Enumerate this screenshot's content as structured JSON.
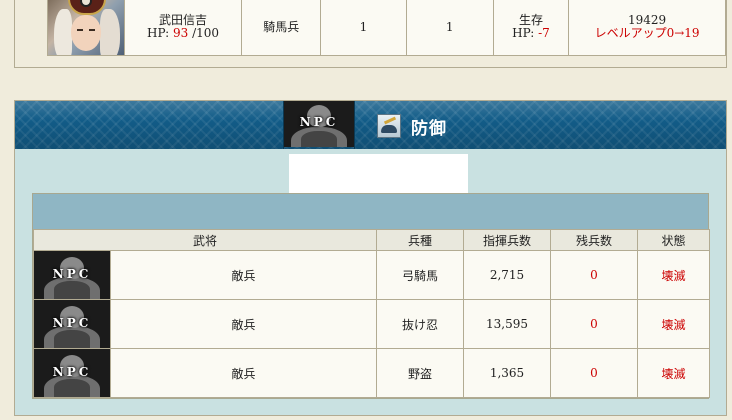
{
  "attacker": {
    "name": "武田信吉",
    "hp_prefix": "HP: ",
    "hp_current": "93",
    "hp_max": " /100",
    "unit_type": "騎馬兵",
    "count_a": "1",
    "count_b": "1",
    "status": "生存",
    "hp_change_prefix": "HP: ",
    "hp_change": "-7",
    "exp": "19429",
    "level_up": "レベルアップ0→19"
  },
  "defense": {
    "title": "防御",
    "header_npc_label": "NPC",
    "columns": [
      "武将",
      "兵種",
      "指揮兵数",
      "残兵数",
      "状態"
    ],
    "rows": [
      {
        "icon_label": "NPC",
        "name": "敵兵",
        "unit_type": "弓騎馬",
        "commanded": "2,715",
        "remaining": "0",
        "status": "壊滅"
      },
      {
        "icon_label": "NPC",
        "name": "敵兵",
        "unit_type": "抜け忍",
        "commanded": "13,595",
        "remaining": "0",
        "status": "壊滅"
      },
      {
        "icon_label": "NPC",
        "name": "敵兵",
        "unit_type": "野盗",
        "commanded": "1,365",
        "remaining": "0",
        "status": "壊滅"
      }
    ]
  },
  "colors": {
    "header_blue": "#125c88",
    "panel_bg": "#c9e1e1",
    "alert_red": "#cc0000"
  },
  "icons": {
    "general_portrait": "samurai-portrait",
    "npc_portrait": "npc-silhouette-icon",
    "defense_icon": "shield-icon"
  }
}
